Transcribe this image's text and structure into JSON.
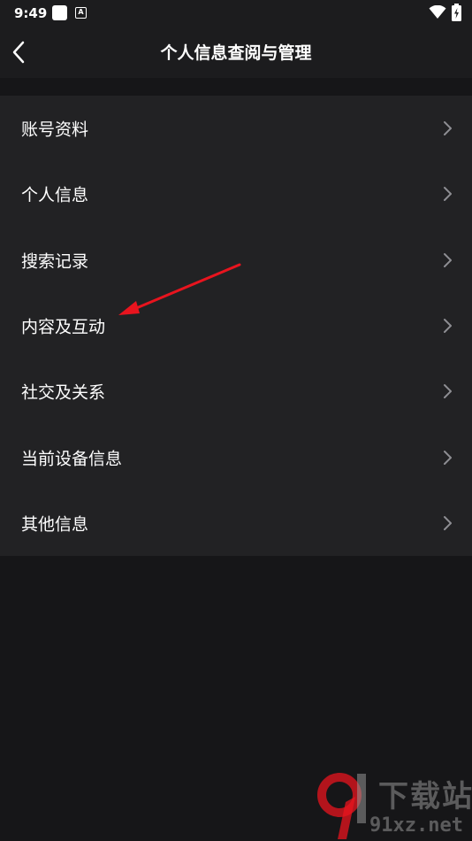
{
  "status_bar": {
    "time": "9:49",
    "notification_badge": "A"
  },
  "header": {
    "title": "个人信息查阅与管理"
  },
  "menu": {
    "items": [
      {
        "label": "账号资料"
      },
      {
        "label": "个人信息"
      },
      {
        "label": "搜索记录"
      },
      {
        "label": "内容及互动"
      },
      {
        "label": "社交及关系"
      },
      {
        "label": "当前设备信息"
      },
      {
        "label": "其他信息"
      }
    ]
  },
  "annotation": {
    "arrow_color": "#e8141e"
  },
  "watermark": {
    "title": "下载站",
    "domain": "91xz.net"
  },
  "colors": {
    "background": "#161618",
    "bar": "#1c1c1e",
    "list_background": "#222224",
    "text": "#ffffff",
    "chevron": "#8e8e93"
  }
}
